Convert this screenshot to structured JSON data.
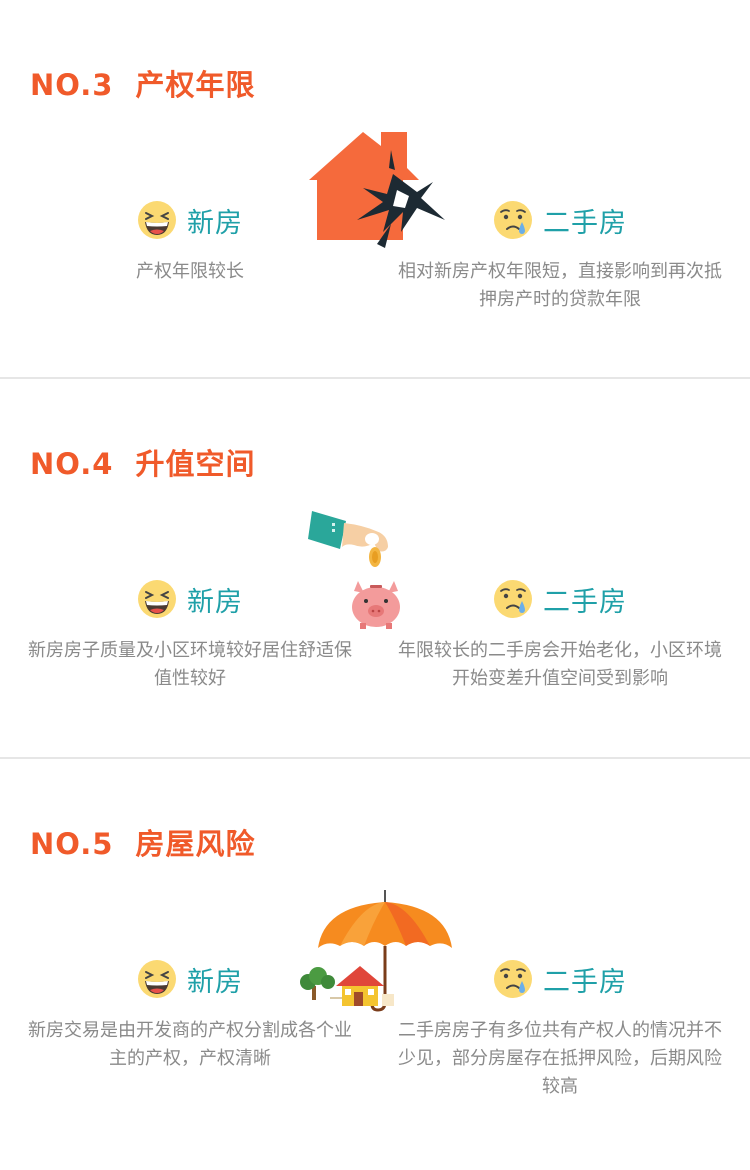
{
  "sections": [
    {
      "number": "NO.3",
      "title": "产权年限",
      "illustration": "cracked-house-icon",
      "new": {
        "label": "新房",
        "face": "laughing-face-icon",
        "desc": "产权年限较长"
      },
      "old": {
        "label": "二手房",
        "face": "sad-face-icon",
        "desc": "相对新房产权年限短，直接影响到再次抵押房产时的贷款年限"
      }
    },
    {
      "number": "NO.4",
      "title": "升值空间",
      "illustration": "piggy-bank-coin-icon",
      "new": {
        "label": "新房",
        "face": "laughing-face-icon",
        "desc": "新房房子质量及小区环境较好居住舒适保值性较好"
      },
      "old": {
        "label": "二手房",
        "face": "sad-face-icon",
        "desc": "年限较长的二手房会开始老化，小区环境开始变差升值空间受到影响"
      }
    },
    {
      "number": "NO.5",
      "title": "房屋风险",
      "illustration": "umbrella-house-icon",
      "new": {
        "label": "新房",
        "face": "laughing-face-icon",
        "desc": "新房交易是由开发商的产权分割成各个业主的产权，产权清晰"
      },
      "old": {
        "label": "二手房",
        "face": "sad-face-icon",
        "desc": "二手房房子有多位共有产权人的情况并不少见，部分房屋存在抵押风险，后期风险较高"
      }
    }
  ],
  "colors": {
    "accent": "#f05a2a",
    "teal": "#1fa0a8",
    "text": "#8a8a8a",
    "divider": "#e6e6e6",
    "face": "#fbd972"
  }
}
